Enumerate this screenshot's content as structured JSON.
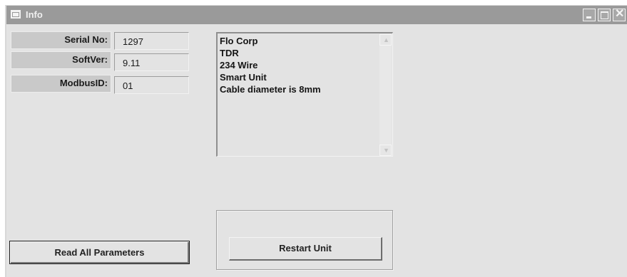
{
  "window": {
    "title": "Info",
    "minimize_glyph": "",
    "maximize_glyph": "",
    "close_glyph": "✕"
  },
  "fields": [
    {
      "label": "Serial No:",
      "value": "1297"
    },
    {
      "label": "SoftVer:",
      "value": "9.11"
    },
    {
      "label": "ModbusID:",
      "value": "01"
    }
  ],
  "info_lines": [
    "Flo Corp",
    "TDR",
    "234 Wire",
    "Smart Unit",
    "Cable diameter is 8mm"
  ],
  "scroll_up_glyph": "▲",
  "scroll_down_glyph": "▼",
  "buttons": {
    "restart": "Restart Unit",
    "read_all": "Read All Parameters"
  },
  "icons": {
    "window": "window-icon",
    "minimize": "minimize-icon",
    "maximize": "maximize-icon",
    "close": "close-icon",
    "scroll_up": "chevron-up-icon",
    "scroll_down": "chevron-down-icon"
  },
  "colors": {
    "titlebar": "#9a9a9a",
    "window_bg": "#e3e3e3",
    "label_bg": "#c9c9c9"
  }
}
